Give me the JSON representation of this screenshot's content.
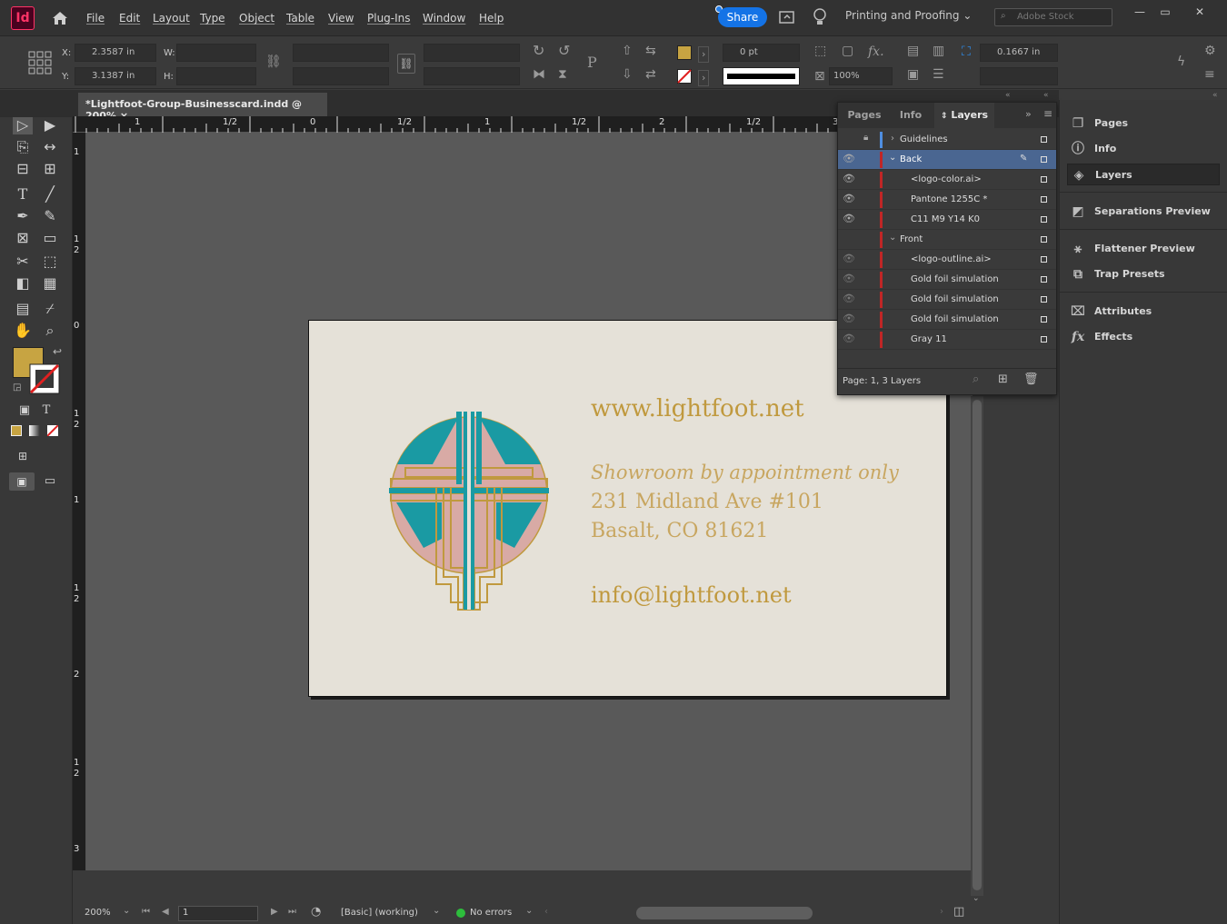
{
  "app": {
    "logo": "Id",
    "window_title": "*Lightfoot-Group-Businesscard.indd @ 200% ×"
  },
  "menu": [
    "File",
    "Edit",
    "Layout",
    "Type",
    "Object",
    "Table",
    "View",
    "Plug-Ins",
    "Window",
    "Help"
  ],
  "header": {
    "share": "Share",
    "workspace": "Printing and Proofing",
    "workspace_chevron": "⌄",
    "search_placeholder": "Adobe Stock"
  },
  "control": {
    "x_label": "X:",
    "x_value": "2.3587 in",
    "y_label": "Y:",
    "y_value": "3.1387 in",
    "w_label": "W:",
    "h_label": "H:",
    "stroke_weight": "0 pt",
    "opacity": "100%",
    "offset": "0.1667 in"
  },
  "rulers": {
    "h_ticks": [
      {
        "t": "1"
      },
      {
        "t": "1/2"
      },
      {
        "t": "0"
      },
      {
        "t": "1/2"
      },
      {
        "t": "1"
      },
      {
        "t": "1/2"
      },
      {
        "t": "2"
      },
      {
        "t": "1/2"
      },
      {
        "t": "3"
      }
    ],
    "v_ticks": [
      "1",
      "1",
      "2",
      "0",
      "1",
      "2",
      "1",
      "1",
      "2",
      "2",
      "1",
      "2",
      "3"
    ]
  },
  "card": {
    "website": "www.lightfoot.net",
    "showroom": "Showroom by appointment only",
    "address1": "231 Midland Ave #101",
    "address2": "Basalt, CO 81621",
    "email": "info@lightfoot.net",
    "colors": {
      "background": "#e5e1d8",
      "gold": "#c0993e",
      "teal": "#1a9aa3",
      "pink": "#d8aaa5",
      "text": "#c0993e"
    }
  },
  "layers_panel": {
    "tabs": [
      "Pages",
      "Info",
      "Layers"
    ],
    "active_tab": "Layers",
    "rows": [
      {
        "name": "Guidelines",
        "level": 0,
        "visible": false,
        "locked": true,
        "expanded": false,
        "color": "#4f8ee0"
      },
      {
        "name": "Back",
        "level": 0,
        "visible": true,
        "locked": false,
        "expanded": true,
        "selected": true,
        "color": "#c02626"
      },
      {
        "name": "<logo-color.ai>",
        "level": 1,
        "visible": true
      },
      {
        "name": "Pantone 1255C *",
        "level": 1,
        "visible": true
      },
      {
        "name": "C11 M9 Y14 K0",
        "level": 1,
        "visible": true
      },
      {
        "name": "Front",
        "level": 0,
        "visible": false,
        "expanded": true
      },
      {
        "name": "<logo-outline.ai>",
        "level": 1,
        "visible": true
      },
      {
        "name": "Gold foil simulation",
        "level": 1,
        "visible": true
      },
      {
        "name": "Gold foil simulation",
        "level": 1,
        "visible": true
      },
      {
        "name": "Gold foil simulation",
        "level": 1,
        "visible": true
      },
      {
        "name": "Gray 11",
        "level": 1,
        "visible": true
      }
    ],
    "footer": "Page: 1, 3 Layers"
  },
  "dock": {
    "groups": [
      [
        {
          "label": "Pages",
          "icon": "pages-icon"
        },
        {
          "label": "Info",
          "icon": "info-icon"
        },
        {
          "label": "Layers",
          "icon": "layers-icon",
          "active": true
        }
      ],
      [
        {
          "label": "Separations Preview",
          "icon": "separations-icon"
        }
      ],
      [
        {
          "label": "Flattener Preview",
          "icon": "flattener-icon"
        },
        {
          "label": "Trap Presets",
          "icon": "trap-icon"
        }
      ],
      [
        {
          "label": "Attributes",
          "icon": "attributes-icon"
        },
        {
          "label": "Effects",
          "icon": "effects-icon"
        }
      ]
    ]
  },
  "status": {
    "zoom": "200%",
    "page": "1",
    "preflight_profile": "[Basic] (working)",
    "errors": "No errors"
  },
  "fill_color": "#c7a442"
}
